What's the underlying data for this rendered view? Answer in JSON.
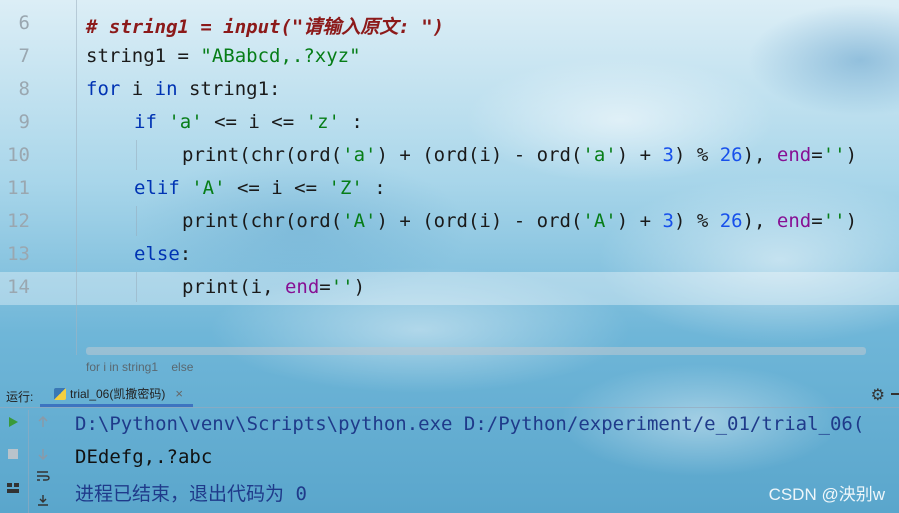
{
  "editor": {
    "line_numbers": [
      "6",
      "7",
      "8",
      "9",
      "10",
      "11",
      "12",
      "13",
      "14"
    ],
    "lines": {
      "l6": "# string1 = input(\"请输入原文: \")",
      "l7_a": "string1 = ",
      "l7_b": "\"ABabcd,.?xyz\"",
      "l8_a": "for",
      "l8_b": " i ",
      "l8_c": "in",
      "l8_d": " string1:",
      "l9_a": "if",
      "l9_b": "'a'",
      "l9_c": " <= i <= ",
      "l9_d": "'z'",
      "l9_e": " :",
      "l10_a": "print(chr(ord(",
      "l10_b": "'a'",
      "l10_c": ") + (ord(i) - ord(",
      "l10_d": "'a'",
      "l10_e": ") + ",
      "l10_f": "3",
      "l10_g": ") % ",
      "l10_h": "26",
      "l10_i": "), ",
      "l10_j": "end",
      "l10_k": "=",
      "l10_l": "''",
      "l10_m": ")",
      "l11_a": "elif",
      "l11_b": "'A'",
      "l11_c": " <= i <= ",
      "l11_d": "'Z'",
      "l11_e": " :",
      "l12_b": "'A'",
      "l12_d": "'A'",
      "l13_a": "else",
      "l13_b": ":",
      "l14_a": "print(i, ",
      "l14_b": "end",
      "l14_c": "=",
      "l14_d": "''",
      "l14_e": ")"
    }
  },
  "breadcrumb": {
    "items": [
      "for i in string1",
      "else"
    ]
  },
  "run_panel": {
    "label": "运行:",
    "tab_label": "trial_06(凯撒密码)",
    "close": "×",
    "gear": "⚙",
    "console": [
      "D:\\Python\\venv\\Scripts\\python.exe D:/Python/experiment/e_01/trial_06(",
      "DEdefg,.?abc",
      "进程已结束，退出代码为 0"
    ]
  },
  "watermark": "CSDN @泱别w",
  "colors": {
    "keyword": "#0033b3",
    "string": "#067d17",
    "number": "#1750eb",
    "kwarg": "#871094",
    "comment": "#8c1a1a",
    "console_system": "#1f3a8a"
  }
}
